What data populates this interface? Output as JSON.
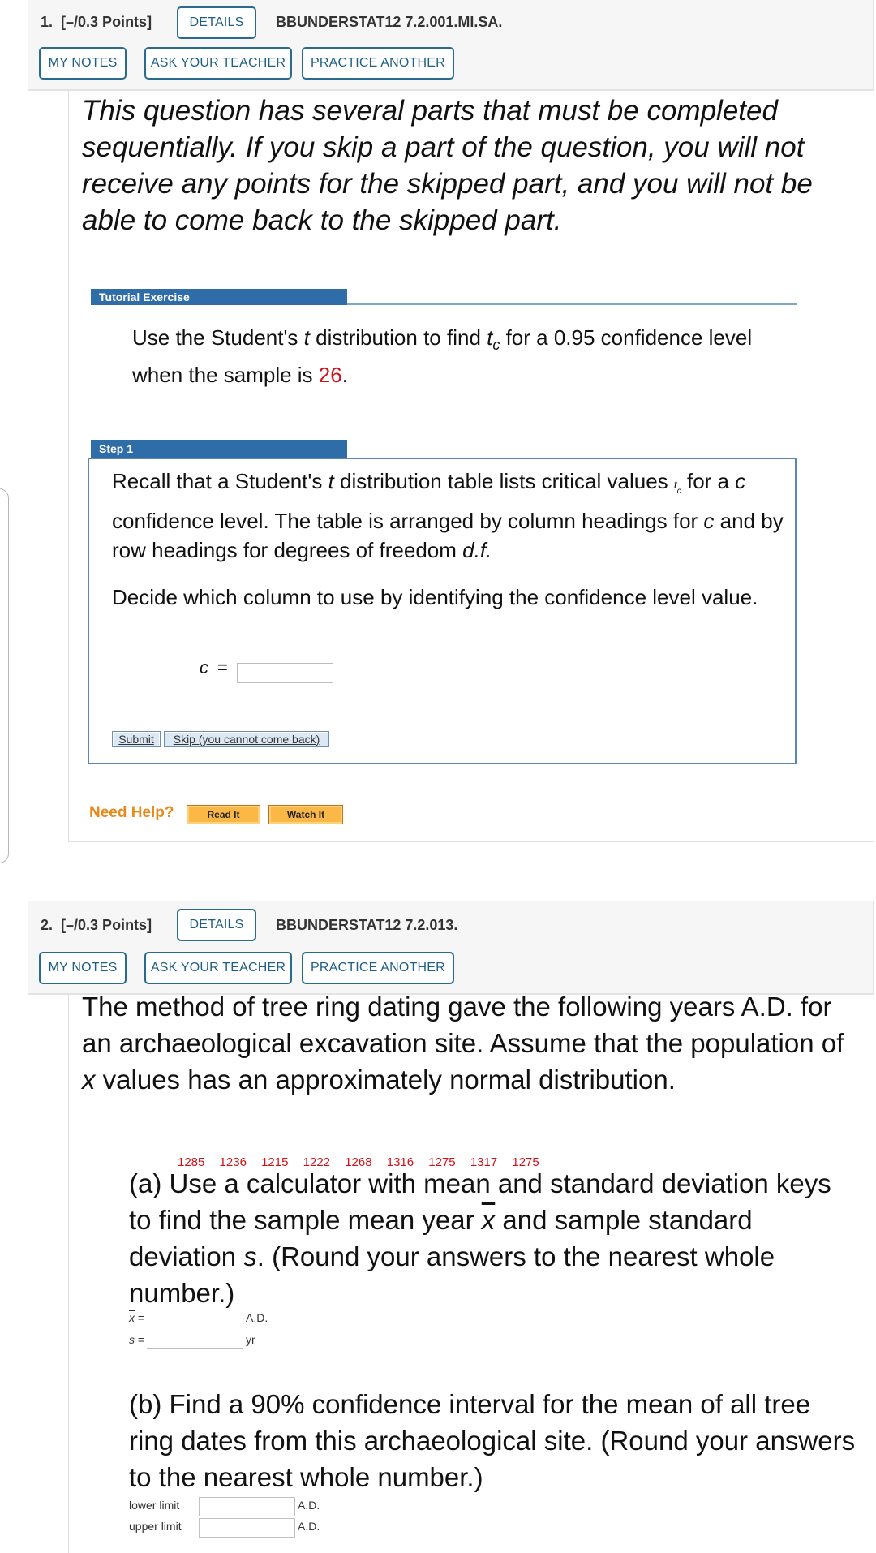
{
  "questions": [
    {
      "number": "1.",
      "points": "[–/0.3 Points]",
      "details_label": "DETAILS",
      "code": "BBUNDERSTAT12 7.2.001.MI.SA.",
      "buttons": {
        "my_notes": "MY NOTES",
        "ask_teacher": "ASK YOUR TEACHER",
        "practice": "PRACTICE ANOTHER"
      },
      "intro": "This question has several parts that must be completed sequentially. If you skip a part of the question, you will not receive any points for the skipped part, and you will not be able to come back to the skipped part.",
      "tutorial": {
        "header": "Tutorial Exercise",
        "text_before_t": "Use the Student's ",
        "t": "t",
        "text_mid": " distribution to find ",
        "tc": "t",
        "tc_sub": "c",
        "text_after": " for a 0.95 confidence level when the sample is ",
        "sample_size": "26",
        "period": "."
      },
      "step": {
        "header": "Step 1",
        "p1_a": "Recall that a Student's ",
        "p1_t": "t",
        "p1_b": " distribution table lists critical values ",
        "p1_tc": "t",
        "p1_tc_sub": "c",
        "p1_c": " for a ",
        "p1_cvar": "c",
        "p1_d": " confidence level. The table is arranged by column headings for ",
        "p1_cvar2": "c",
        "p1_e": " and by row headings for degrees of freedom ",
        "p1_df": "d.f.",
        "p2": "Decide which column to use by identifying the confidence level value.",
        "c_label": "c",
        "equals": "=",
        "c_value": "",
        "submit_label": "Submit",
        "skip_label": "Skip (you cannot come back)"
      },
      "help": {
        "label": "Need Help?",
        "read_it": "Read It",
        "watch_it": "Watch It"
      }
    },
    {
      "number": "2.",
      "points": "[–/0.3 Points]",
      "details_label": "DETAILS",
      "code": "BBUNDERSTAT12 7.2.013.",
      "buttons": {
        "my_notes": "MY NOTES",
        "ask_teacher": "ASK YOUR TEACHER",
        "practice": "PRACTICE ANOTHER"
      },
      "intro_a": "The method of tree ring dating gave the following years A.D. for an archaeological excavation site. Assume that the population of ",
      "intro_x": "x",
      "intro_b": " values has an approximately normal distribution.",
      "data_values": [
        "1285",
        "1236",
        "1215",
        "1222",
        "1268",
        "1316",
        "1275",
        "1317",
        "1275"
      ],
      "part_a": {
        "text_a": "(a) Use a calculator with mean and standard deviation keys to find the sample mean year ",
        "xbar": "x",
        "text_b": " and sample standard deviation ",
        "s": "s",
        "text_c": ". (Round your answers to the nearest whole number.)",
        "xbar_label": "x",
        "s_label": "s",
        "eq": "=",
        "xbar_value": "",
        "s_value": "",
        "xbar_unit": "A.D.",
        "s_unit": "yr"
      },
      "part_b": {
        "text": "(b) Find a 90% confidence interval for the mean of all tree ring dates from this archaeological site. (Round your answers to the nearest whole number.)",
        "lower_label": "lower limit",
        "upper_label": "upper limit",
        "lower_value": "",
        "upper_value": "",
        "lower_unit": "A.D.",
        "upper_unit": "A.D."
      }
    }
  ],
  "colors": {
    "accent_blue": "#2f6da9",
    "button_border": "#2a6a8f",
    "highlight_red": "#d0111a",
    "help_orange": "#e8891c"
  }
}
